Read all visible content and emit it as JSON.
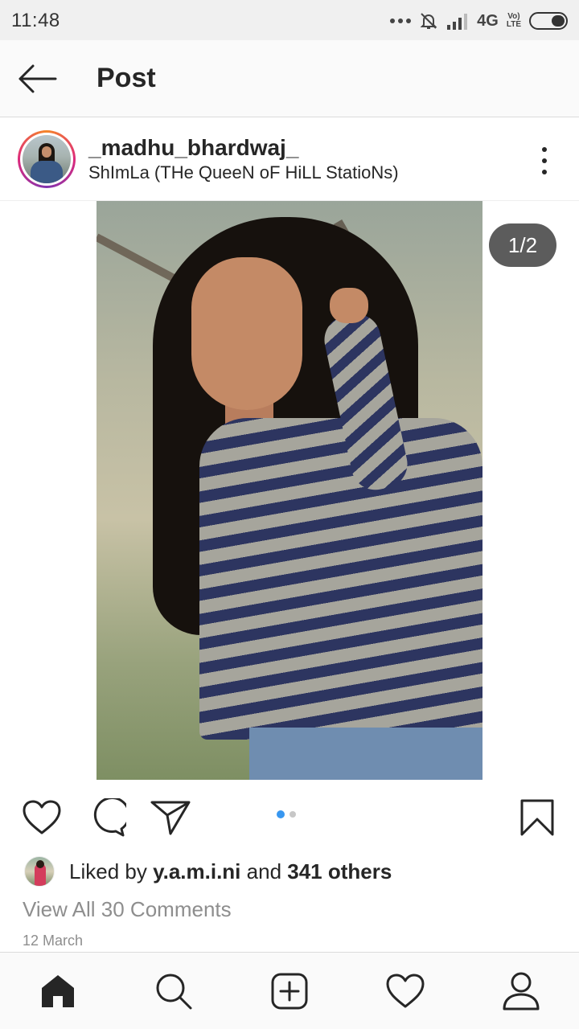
{
  "status_bar": {
    "time": "11:48",
    "network": "4G",
    "volte_top": "Vo)",
    "volte_bottom": "LTE",
    "icons": [
      "more-dots-icon",
      "bell-muted-icon",
      "signal-icon",
      "battery-icon"
    ]
  },
  "header": {
    "title": "Post",
    "back_icon": "arrow-left-icon"
  },
  "post": {
    "username": "_madhu_bhardwaj_",
    "location": "ShImLa (THe QueeN oF HiLL StatioNs)",
    "image_counter": "1/2",
    "carousel": {
      "total": 2,
      "active_index": 0,
      "active_color": "#3897f0",
      "inactive_color": "#c7c7c7"
    },
    "likes_prefix": "Liked by ",
    "liker": "y.a.m.i.ni",
    "likes_middle": " and ",
    "others": "341 others",
    "comments_link": "View All 30 Comments",
    "date": "12 March"
  },
  "actions": {
    "icons": [
      "heart-icon",
      "comment-icon",
      "share-icon",
      "bookmark-icon"
    ]
  },
  "bottom_nav": {
    "items": [
      "home-icon",
      "search-icon",
      "add-post-icon",
      "activity-heart-icon",
      "profile-icon"
    ],
    "active": "home-icon"
  },
  "colors": {
    "text": "#262626",
    "muted": "#8e8e8e",
    "accent": "#3897f0"
  }
}
